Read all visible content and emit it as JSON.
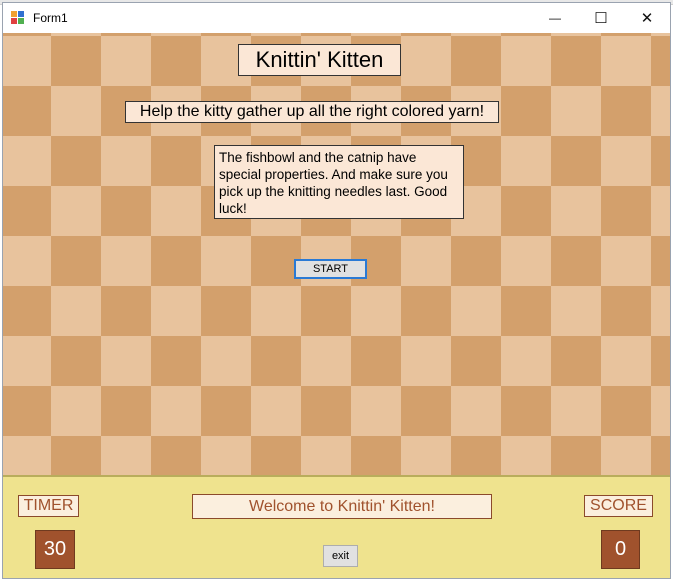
{
  "window": {
    "title": "Form1",
    "icon": "windows-form-icon",
    "controls": {
      "minimize_glyph": "—",
      "maximize_glyph": "☐",
      "close_glyph": "✕"
    }
  },
  "game": {
    "title": "Knittin' Kitten",
    "subtitle": "Help the kitty gather up all the right colored yarn!",
    "instructions": "The fishbowl and the catnip have special properties. And make sure you pick up the knitting needles last. Good luck!",
    "start_label": "START"
  },
  "panel": {
    "timer_label": "TIMER",
    "timer_value": "30",
    "welcome_message": "Welcome to Knittin' Kitten!",
    "score_label": "SCORE",
    "score_value": "0",
    "exit_label": "exit"
  },
  "colors": {
    "board_light": "#e8c39d",
    "board_dark": "#d3a06c",
    "panel_bg": "#efe38e",
    "accent_brown": "#a0522d",
    "focus_blue": "#2a7ad5"
  }
}
